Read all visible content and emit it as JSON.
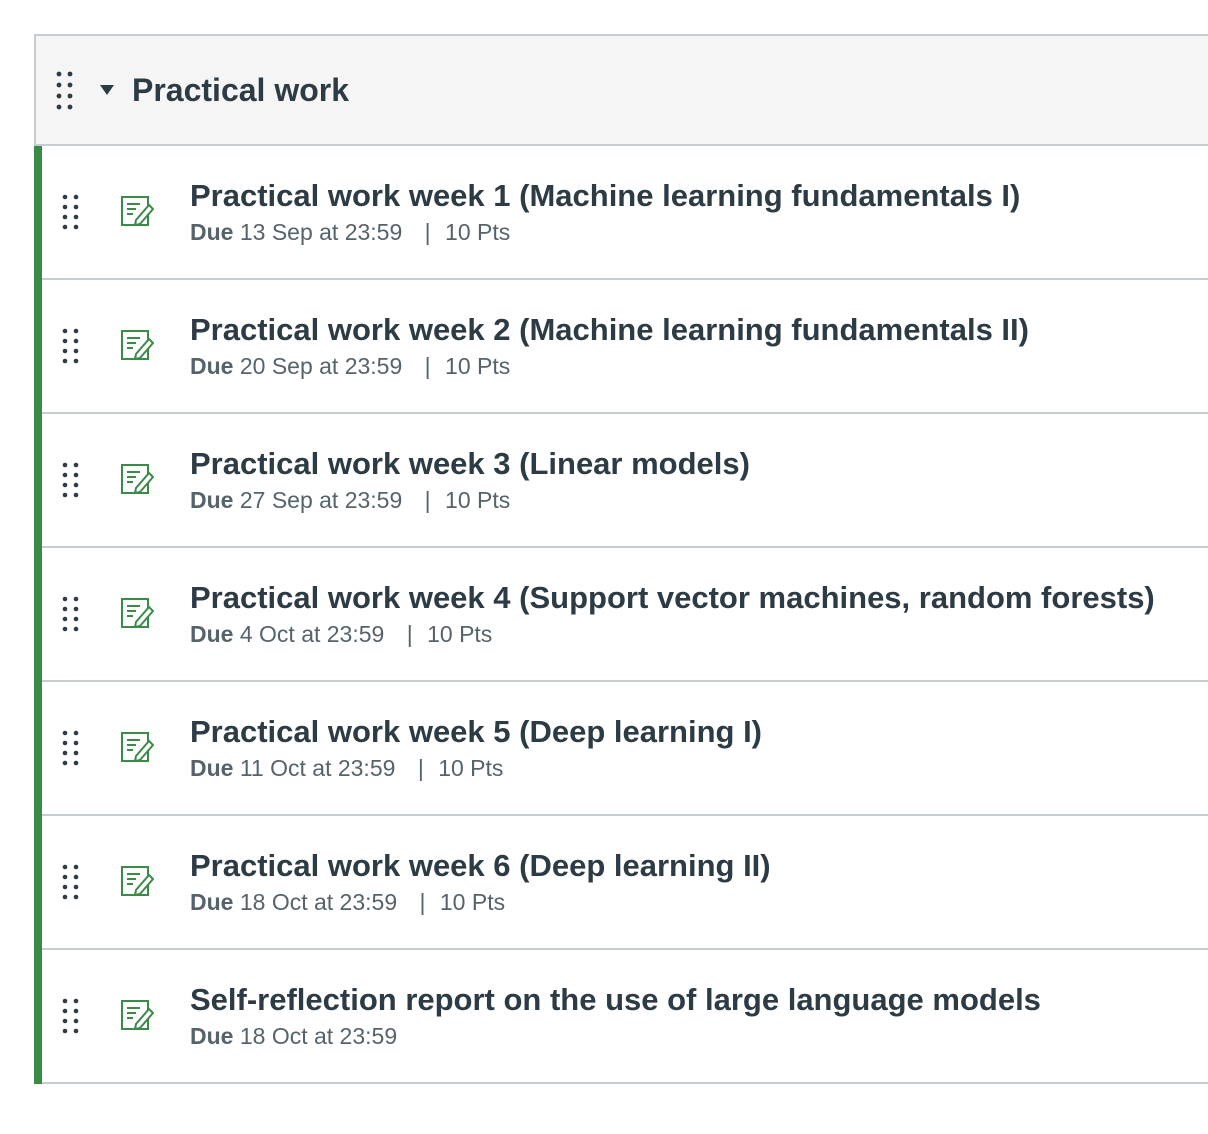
{
  "module": {
    "title": "Practical work",
    "accent_color": "#3a8a48",
    "items": [
      {
        "title": "Practical work week 1 (Machine learning fundamentals I)",
        "due_label": "Due",
        "due_date": "13 Sep at 23:59",
        "separator": "|",
        "points": "10 Pts",
        "icon": "assignment-icon"
      },
      {
        "title": "Practical work week 2 (Machine learning fundamentals II)",
        "due_label": "Due",
        "due_date": "20 Sep at 23:59",
        "separator": "|",
        "points": "10 Pts",
        "icon": "assignment-icon"
      },
      {
        "title": "Practical work week 3 (Linear models)",
        "due_label": "Due",
        "due_date": "27 Sep at 23:59",
        "separator": "|",
        "points": "10 Pts",
        "icon": "assignment-icon"
      },
      {
        "title": "Practical work week 4 (Support vector machines, random forests)",
        "due_label": "Due",
        "due_date": "4 Oct at 23:59",
        "separator": "|",
        "points": "10 Pts",
        "icon": "assignment-icon"
      },
      {
        "title": "Practical work week 5 (Deep learning I)",
        "due_label": "Due",
        "due_date": "11 Oct at 23:59",
        "separator": "|",
        "points": "10 Pts",
        "icon": "assignment-icon"
      },
      {
        "title": "Practical work week 6 (Deep learning II)",
        "due_label": "Due",
        "due_date": "18 Oct at 23:59",
        "separator": "|",
        "points": "10 Pts",
        "icon": "assignment-icon"
      },
      {
        "title": "Self-reflection report on the use of large language models",
        "due_label": "Due",
        "due_date": "18 Oct at 23:59",
        "icon": "assignment-icon"
      }
    ]
  }
}
